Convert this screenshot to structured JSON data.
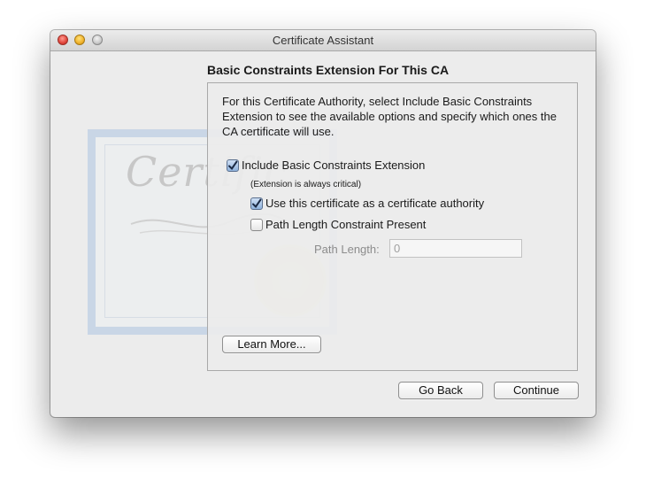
{
  "window": {
    "title": "Certificate Assistant"
  },
  "background": {
    "watermark_text": "Certific"
  },
  "page": {
    "heading": "Basic Constraints Extension For This CA",
    "description": "For this Certificate Authority, select Include Basic Constraints Extension to see the available options and specify which ones the CA certificate will use.",
    "include_extension": {
      "label": "Include Basic Constraints Extension",
      "checked": true
    },
    "critical_note": "(Extension is always critical)",
    "use_as_ca": {
      "label": "Use this certificate as a certificate authority",
      "checked": true
    },
    "path_length_present": {
      "label": "Path Length Constraint Present",
      "checked": false
    },
    "path_length": {
      "label": "Path Length:",
      "value": "0"
    },
    "learn_more_label": "Learn More..."
  },
  "footer": {
    "back_label": "Go Back",
    "continue_label": "Continue"
  },
  "colors": {
    "window_bg": "#ececec",
    "check_fill": "#8fb2dc"
  }
}
